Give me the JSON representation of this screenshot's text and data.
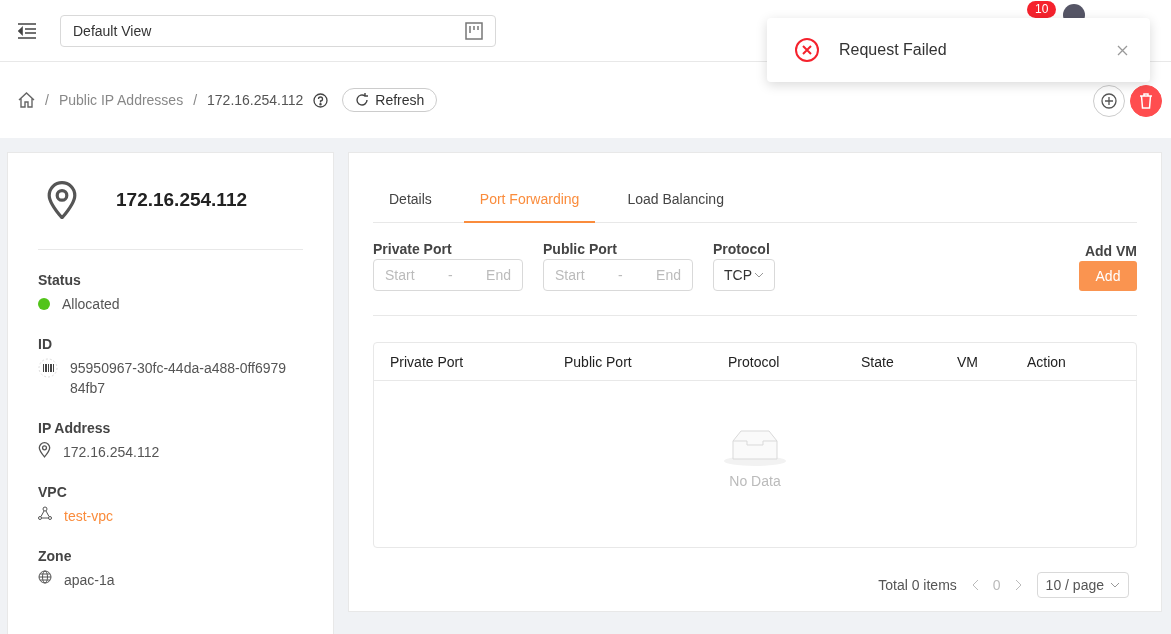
{
  "header": {
    "view_select": {
      "value": "Default View"
    },
    "notification_badge": "10"
  },
  "toast": {
    "message": "Request Failed"
  },
  "breadcrumb": {
    "separator": "/",
    "items": [
      "Public IP Addresses",
      "172.16.254.112"
    ],
    "refresh_button": "Refresh"
  },
  "summary": {
    "title": "172.16.254.112",
    "fields": [
      {
        "kind": "status",
        "label": "Status",
        "value": "Allocated",
        "color": "#52c41a"
      },
      {
        "kind": "id",
        "label": "ID",
        "value": "95950967-30fc-44da-a488-0ff697984fb7"
      },
      {
        "kind": "ip",
        "label": "IP Address",
        "value": "172.16.254.112"
      },
      {
        "kind": "link",
        "label": "VPC",
        "value": "test-vpc"
      },
      {
        "kind": "zone",
        "label": "Zone",
        "value": "apac-1a"
      }
    ]
  },
  "tabs": [
    {
      "label": "Details",
      "selected": false
    },
    {
      "label": "Port Forwarding",
      "selected": true
    },
    {
      "label": "Load Balancing",
      "selected": false
    }
  ],
  "form": {
    "private_port": {
      "label": "Private Port",
      "start_placeholder": "Start",
      "separator": "-",
      "end_placeholder": "End"
    },
    "public_port": {
      "label": "Public Port",
      "start_placeholder": "Start",
      "separator": "-",
      "end_placeholder": "End"
    },
    "protocol": {
      "label": "Protocol",
      "value": "TCP"
    },
    "add_vm": {
      "label": "Add VM",
      "button": "Add"
    }
  },
  "table": {
    "columns": [
      "Private Port",
      "Public Port",
      "Protocol",
      "State",
      "VM",
      "Action"
    ],
    "empty_text": "No Data"
  },
  "pagination": {
    "total": "Total 0 items",
    "page": "0",
    "page_size": "10 / page"
  }
}
